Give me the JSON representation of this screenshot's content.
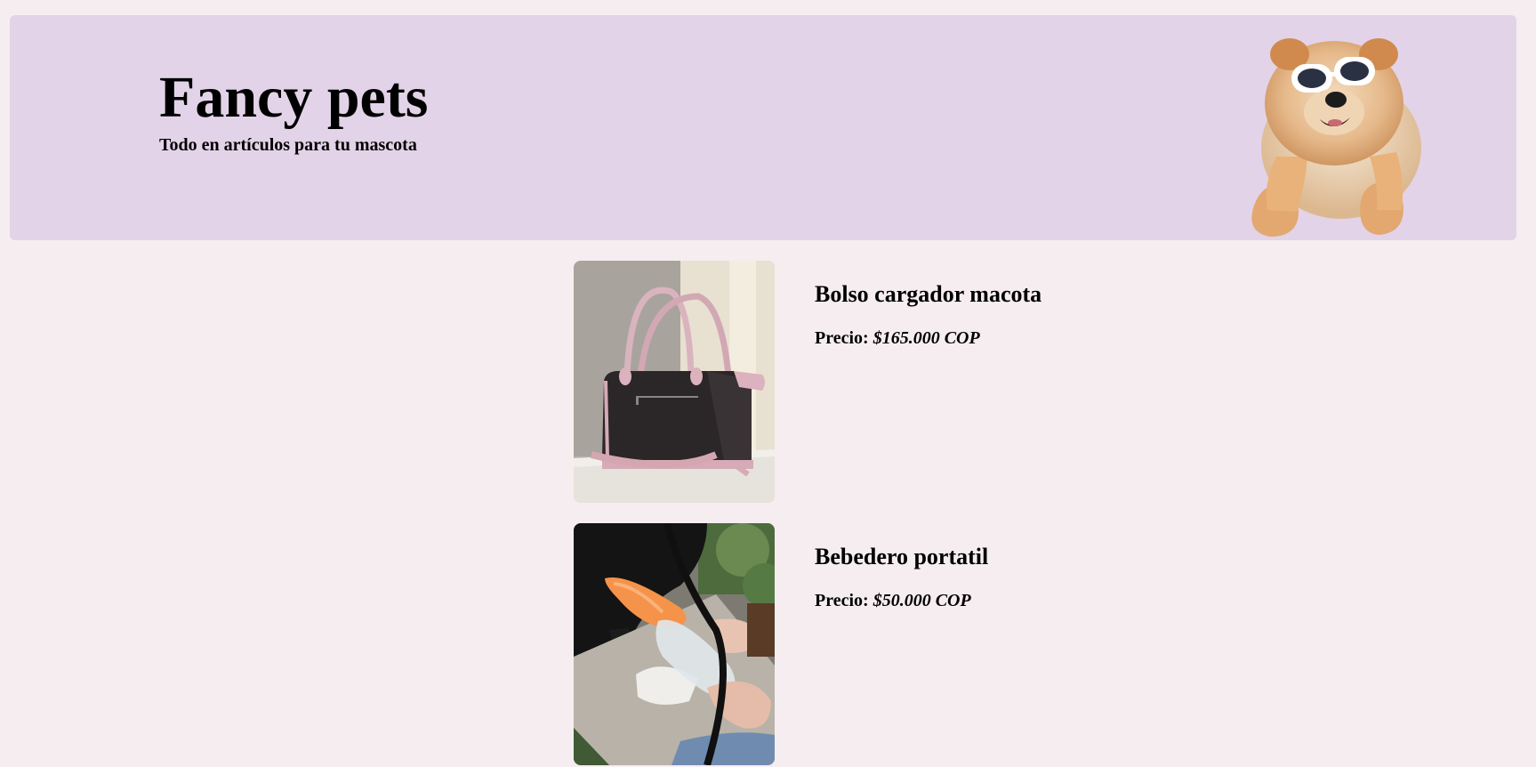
{
  "header": {
    "title": "Fancy pets",
    "subtitle": "Todo en artículos para tu mascota",
    "mascot_icon": "dog-with-sunglasses-icon"
  },
  "products": [
    {
      "name": "Bolso cargador macota",
      "price_label": "Precio:",
      "price_value": "$165.000 COP",
      "image_icon": "pet-carrier-bag-image"
    },
    {
      "name": "Bebedero portatil",
      "price_label": "Precio:",
      "price_value": "$50.000 COP",
      "image_icon": "portable-water-bottle-image"
    }
  ],
  "colors": {
    "page_background": "#f6edf0",
    "header_background": "#e3d3e8",
    "text": "#000000"
  }
}
